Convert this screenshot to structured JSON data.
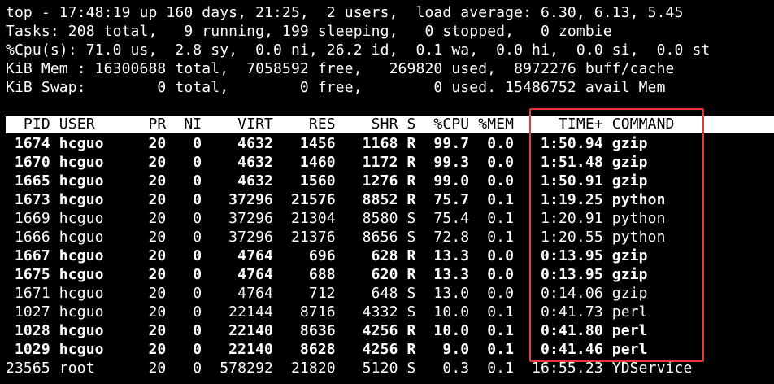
{
  "summary": {
    "line1": "top - 17:48:19 up 160 days, 21:25,  2 users,  load average: 6.30, 6.13, 5.45",
    "line2": "Tasks: 208 total,   9 running, 199 sleeping,   0 stopped,   0 zombie",
    "line3": "%Cpu(s): 71.0 us,  2.8 sy,  0.0 ni, 26.2 id,  0.1 wa,  0.0 hi,  0.0 si,  0.0 st",
    "line4": "KiB Mem : 16300688 total,  7058592 free,   269820 used,  8972276 buff/cache",
    "line5": "KiB Swap:        0 total,        0 free,        0 used. 15486752 avail Mem"
  },
  "table": {
    "header": "  PID USER      PR  NI    VIRT    RES    SHR S  %CPU %MEM     TIME+ COMMAND",
    "rows": [
      " 1674 hcguo     20   0    4632   1456   1168 R  99.7  0.0   1:50.94 gzip",
      " 1670 hcguo     20   0    4632   1460   1172 R  99.3  0.0   1:51.48 gzip",
      " 1665 hcguo     20   0    4632   1560   1276 R  99.0  0.0   1:50.91 gzip",
      " 1673 hcguo     20   0   37296  21576   8852 R  75.7  0.1   1:19.25 python",
      " 1669 hcguo     20   0   37296  21304   8580 S  75.4  0.1   1:20.91 python",
      " 1666 hcguo     20   0   37296  21376   8656 S  72.8  0.1   1:20.55 python",
      " 1667 hcguo     20   0    4764    696    628 R  13.3  0.0   0:13.95 gzip",
      " 1675 hcguo     20   0    4764    688    620 R  13.3  0.0   0:13.95 gzip",
      " 1671 hcguo     20   0    4764    712    648 S  13.0  0.0   0:14.06 gzip",
      " 1027 hcguo     20   0   22144   8716   4332 S  10.0  0.1   0:41.73 perl",
      " 1028 hcguo     20   0   22140   8636   4256 R  10.0  0.1   0:41.80 perl",
      " 1029 hcguo     20   0   22140   8628   4256 R   9.0  0.1   0:41.46 perl",
      "23565 root      20   0  578292  21820   5120 S   0.3  0.1  16:55.23 YDService"
    ]
  },
  "colors": {
    "background": "#000000",
    "text": "#ffffff",
    "header_bg": "#ffffff",
    "header_text": "#000000",
    "annotation_box": "#e53935"
  }
}
